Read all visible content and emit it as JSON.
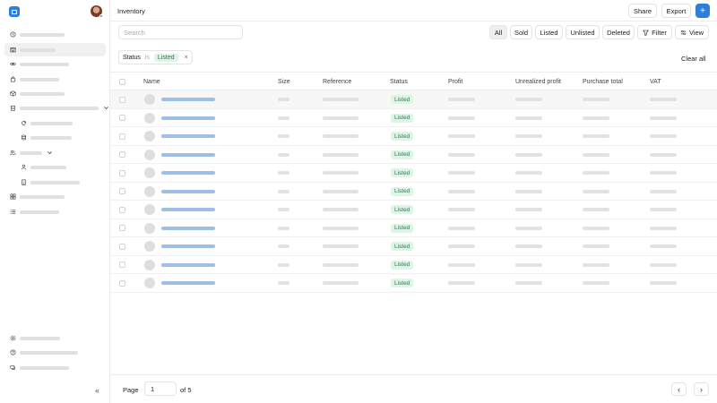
{
  "sidebar": {
    "nav": [
      {
        "icon": "clock-icon"
      },
      {
        "icon": "store-icon",
        "active": true
      },
      {
        "icon": "eye-icon"
      },
      {
        "icon": "bag-icon"
      },
      {
        "icon": "box-icon"
      },
      {
        "icon": "clipboard-icon",
        "expandable": true
      },
      {
        "icon": "refresh-icon",
        "child": true
      },
      {
        "icon": "database-icon",
        "child": true
      },
      {
        "icon": "users-icon",
        "expandable": true
      },
      {
        "icon": "user-icon",
        "child": true
      },
      {
        "icon": "building-icon",
        "child": true
      },
      {
        "icon": "grid-icon"
      },
      {
        "icon": "list-icon"
      }
    ],
    "bottom_nav": [
      {
        "icon": "gear-icon"
      },
      {
        "icon": "help-icon"
      },
      {
        "icon": "chat-icon"
      }
    ],
    "collapse_label": "«"
  },
  "header": {
    "title": "Inventory",
    "share_label": "Share",
    "export_label": "Export",
    "add_label": "+"
  },
  "toolbar": {
    "search_placeholder": "Search",
    "filters": [
      "All",
      "Sold",
      "Listed",
      "Unlisted",
      "Deleted"
    ],
    "selected_filter": "All",
    "filter_label": "Filter",
    "view_label": "View"
  },
  "active_filter": {
    "field": "Status",
    "operator": "is",
    "value": "Listed",
    "remove_label": "×"
  },
  "clear_all_label": "Clear all",
  "table": {
    "columns": [
      "Name",
      "Size",
      "Reference",
      "Status",
      "Profit",
      "Unrealized profit",
      "Purchase total",
      "VAT"
    ],
    "rows": [
      {
        "status": "Listed"
      },
      {
        "status": "Listed"
      },
      {
        "status": "Listed"
      },
      {
        "status": "Listed"
      },
      {
        "status": "Listed"
      },
      {
        "status": "Listed"
      },
      {
        "status": "Listed"
      },
      {
        "status": "Listed"
      },
      {
        "status": "Listed"
      },
      {
        "status": "Listed"
      },
      {
        "status": "Listed"
      }
    ]
  },
  "pagination": {
    "page_label": "Page",
    "current_page": "1",
    "of_label": "of 5",
    "prev_label": "‹",
    "next_label": "›"
  },
  "colors": {
    "accent": "#2f7fd8",
    "status_bg": "#dff3e6",
    "status_text": "#2e7d4f"
  }
}
